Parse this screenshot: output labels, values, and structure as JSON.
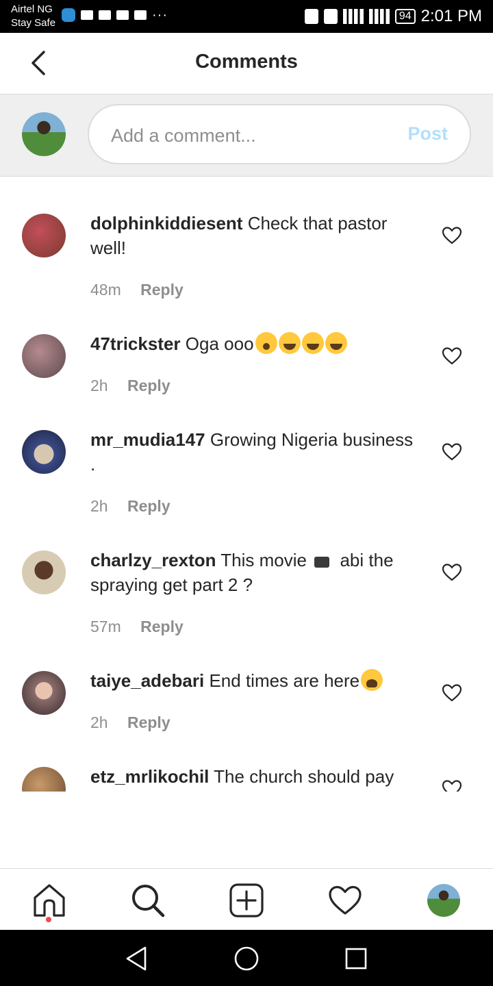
{
  "status_bar": {
    "carrier_line1": "Airtel NG",
    "carrier_line2": "Stay Safe",
    "battery": "94",
    "time": "2:01 PM",
    "left_icons": [
      "shield-icon",
      "activity-icon",
      "mail-icon",
      "n-icon",
      "volume-icon"
    ],
    "right_icons": [
      "bluetooth-icon",
      "vibrate-icon",
      "eye-icon",
      "signal-3g-icon",
      "signal-4g-icon"
    ],
    "more": "···"
  },
  "header": {
    "title": "Comments"
  },
  "compose": {
    "placeholder": "Add a comment...",
    "post_label": "Post",
    "post_color": "#b2dffc"
  },
  "comments": [
    {
      "username": "dolphinkiddiesent",
      "text": "Check that pastor well!",
      "time": "48m",
      "reply": "Reply",
      "avatar_colors": [
        "#c24f5a",
        "#7b3a2f"
      ]
    },
    {
      "username": "47trickster",
      "text": "Oga ooo",
      "emojis": [
        "surprised-emoji",
        "tears-of-joy-emoji",
        "tears-of-joy-emoji",
        "tears-of-joy-emoji"
      ],
      "time": "2h",
      "reply": "Reply",
      "avatar_colors": [
        "#b58a8e",
        "#5c4a4e"
      ]
    },
    {
      "username": "mr_mudia147",
      "text": "Growing Nigeria business .",
      "time": "2h",
      "reply": "Reply",
      "avatar_colors": [
        "#3b4a86",
        "#1c2340"
      ]
    },
    {
      "username": "charlzy_rexton",
      "text_before": "This movie",
      "text_after": "abi the spraying get part 2 ?",
      "emojis": [
        "movie-camera-emoji"
      ],
      "time": "57m",
      "reply": "Reply",
      "avatar_colors": [
        "#d8cbb3",
        "#5a3b2a"
      ]
    },
    {
      "username": "taiye_adebari",
      "text": "End times are here",
      "emojis": [
        "loudly-crying-emoji"
      ],
      "time": "2h",
      "reply": "Reply",
      "avatar_colors": [
        "#8a6d6b",
        "#3b2a2e"
      ]
    },
    {
      "username": "etz_mrlikochil",
      "text": "The church should pay",
      "avatar_colors": [
        "#6b4a2e",
        "#c99a6b"
      ]
    }
  ],
  "bottom_nav": {
    "items": [
      "home-icon",
      "search-icon",
      "new-post-icon",
      "activity-heart-icon",
      "profile-avatar"
    ],
    "notification_color": "#ed4956"
  },
  "system_nav": {
    "items": [
      "back-triangle-icon",
      "home-circle-icon",
      "recents-square-icon"
    ]
  }
}
